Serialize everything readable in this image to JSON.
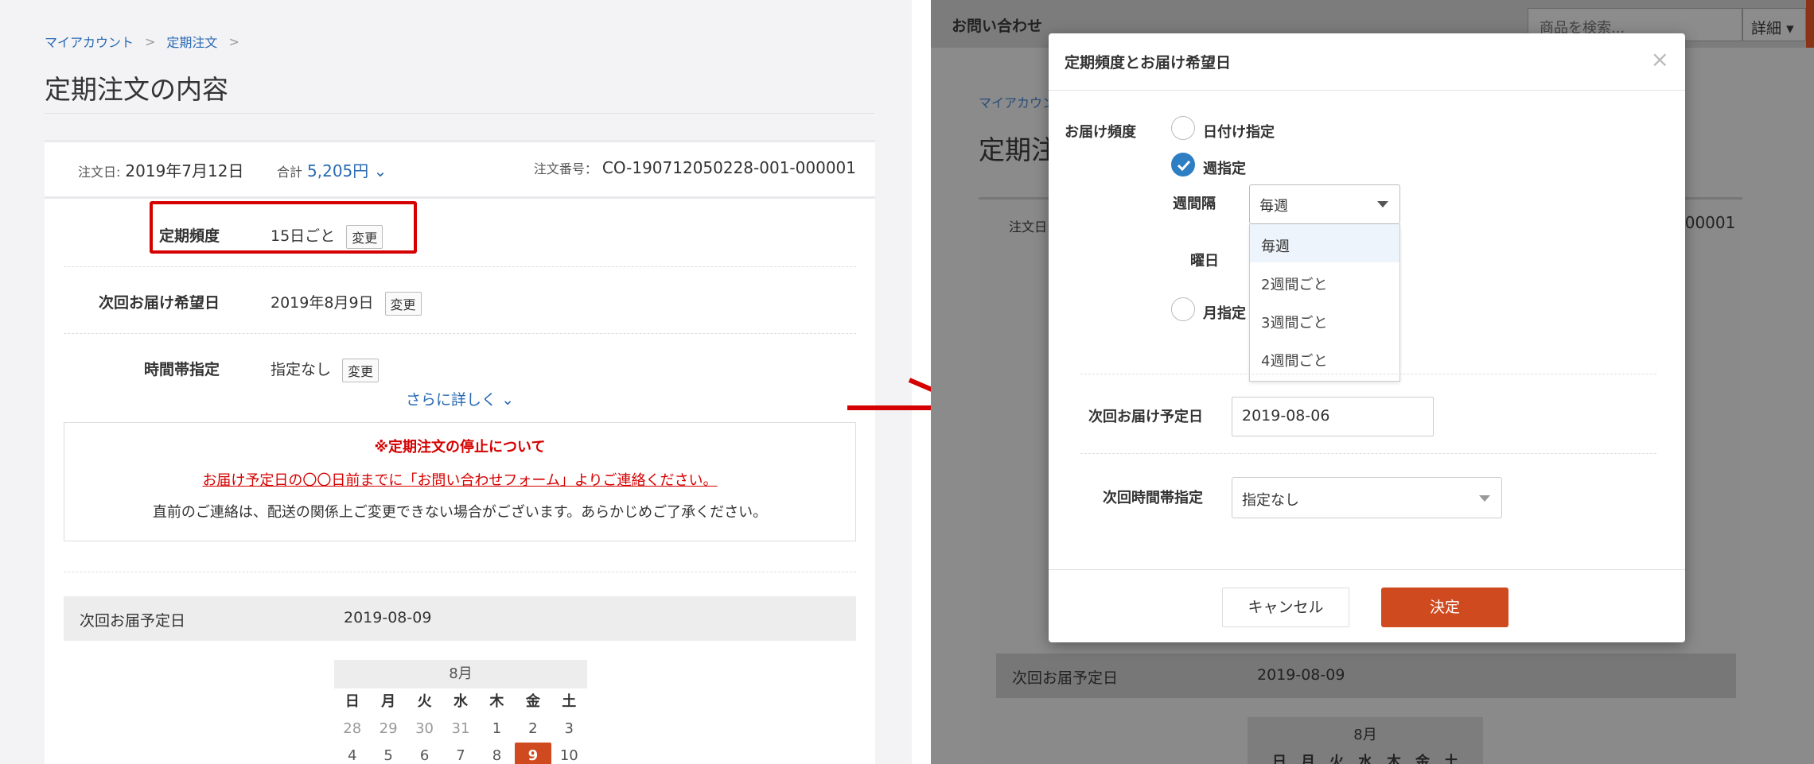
{
  "left": {
    "breadcrumb": [
      "マイアカウント",
      "定期注文"
    ],
    "page_title": "定期注文の内容",
    "summary": {
      "order_date_label": "注文日:",
      "order_date": "2019年7月12日",
      "total_label": "合計",
      "total": "5,205円",
      "order_no_label": "注文番号：",
      "order_no": "CO-190712050228-001-000001"
    },
    "rows": [
      {
        "label": "定期頻度",
        "value": "15日ごと",
        "button": "変更"
      },
      {
        "label": "次回お届け希望日",
        "value": "2019年8月9日",
        "button": "変更"
      },
      {
        "label": "時間帯指定",
        "value": "指定なし",
        "button": "変更"
      }
    ],
    "more_link": "さらに詳しく",
    "notice": {
      "title": "※定期注文の停止について",
      "link": "お届け予定日の〇〇日前までに「お問い合わせフォーム」よりご連絡ください。",
      "text": "直前のご連絡は、配送の関係上ご変更できない場合がございます。あらかじめご了承ください。"
    },
    "next_delivery": {
      "label": "次回お届予定日",
      "value": "2019-08-09"
    },
    "calendar": {
      "month": "8月",
      "weekdays": [
        "日",
        "月",
        "火",
        "水",
        "木",
        "金",
        "土"
      ],
      "days": [
        "28",
        "29",
        "30",
        "31",
        "1",
        "2",
        "3",
        "4",
        "5",
        "6",
        "7",
        "8",
        "9",
        "10"
      ],
      "selected": "9"
    }
  },
  "right": {
    "topbar": {
      "brand": "お問い合わせ",
      "search_placeholder": "商品を検索...",
      "detail": "詳細"
    },
    "bg": {
      "breadcrumb": "マイアカウン",
      "title": "定期注",
      "order_label": "注文日:",
      "order_no_tail": "000001",
      "next_label": "次回お届予定日",
      "next_value": "2019-08-09",
      "cal_month": "8月",
      "cal_weekdays": "日　月　火　水　木　金　土"
    },
    "modal": {
      "title": "定期頻度とお届け希望日",
      "close": "×",
      "frequency_label": "お届け頻度",
      "opt_date": "日付け指定",
      "opt_week": "週指定",
      "opt_month": "月指定",
      "interval_label": "週間隔",
      "interval_value": "毎週",
      "interval_options": [
        "毎週",
        "2週間ごと",
        "3週間ごと",
        "4週間ごと"
      ],
      "weekday_label": "曜日",
      "next_date_label": "次回お届け予定日",
      "next_date_value": "2019-08-06",
      "time_label": "次回時間帯指定",
      "time_value": "指定なし",
      "cancel": "キャンセル",
      "ok": "決定"
    },
    "colors": {
      "accent": "#cf4a1f",
      "check": "#2e7ec4",
      "overlay": "#8b8b8b"
    }
  }
}
